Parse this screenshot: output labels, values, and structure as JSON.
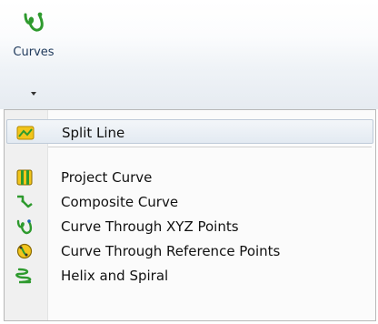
{
  "ribbon": {
    "button": {
      "label": "Curves",
      "icon": "curves-icon"
    }
  },
  "menu": {
    "items": [
      {
        "label": "Split Line",
        "icon": "split-line-icon"
      },
      {
        "label": "Project Curve",
        "icon": "project-curve-icon"
      },
      {
        "label": "Composite Curve",
        "icon": "composite-curve-icon"
      },
      {
        "label": "Curve Through XYZ Points",
        "icon": "curve-xyz-points-icon"
      },
      {
        "label": "Curve Through Reference Points",
        "icon": "curve-reference-points-icon"
      },
      {
        "label": "Helix and Spiral",
        "icon": "helix-spiral-icon"
      }
    ]
  },
  "colors": {
    "icon_green": "#2e9a2e",
    "icon_yellow": "#f2c51c",
    "label_blue": "#1e395b"
  }
}
